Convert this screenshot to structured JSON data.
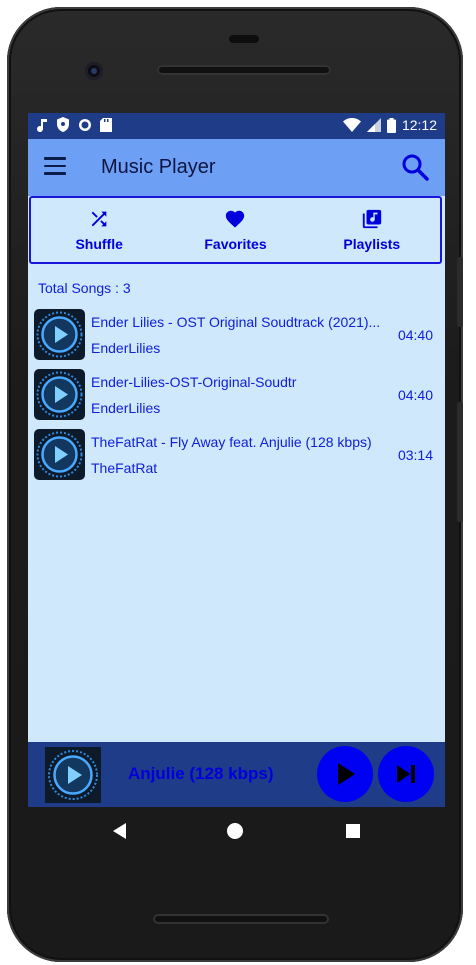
{
  "status": {
    "time": "12:12"
  },
  "toolbar": {
    "title": "Music Player"
  },
  "tabs": [
    {
      "label": "Shuffle",
      "icon": "shuffle-icon"
    },
    {
      "label": "Favorites",
      "icon": "heart-icon"
    },
    {
      "label": "Playlists",
      "icon": "playlist-icon"
    }
  ],
  "total_songs": "Total Songs : 3",
  "songs": [
    {
      "title": "Ender Lilies - OST Original Soudtrack (2021)...",
      "artist": "EnderLilies",
      "duration": "04:40"
    },
    {
      "title": "Ender-Lilies-OST-Original-Soudtr",
      "artist": "EnderLilies",
      "duration": "04:40"
    },
    {
      "title": "TheFatRat - Fly Away feat. Anjulie (128 kbps)",
      "artist": "TheFatRat",
      "duration": "03:14"
    }
  ],
  "now_playing": {
    "title": "Anjulie (128 kbps)"
  },
  "colors": {
    "accent": "#0000f2",
    "toolbar": "#6d9ff5",
    "statusbar": "#1f3c88",
    "background": "#cfe8fb"
  }
}
